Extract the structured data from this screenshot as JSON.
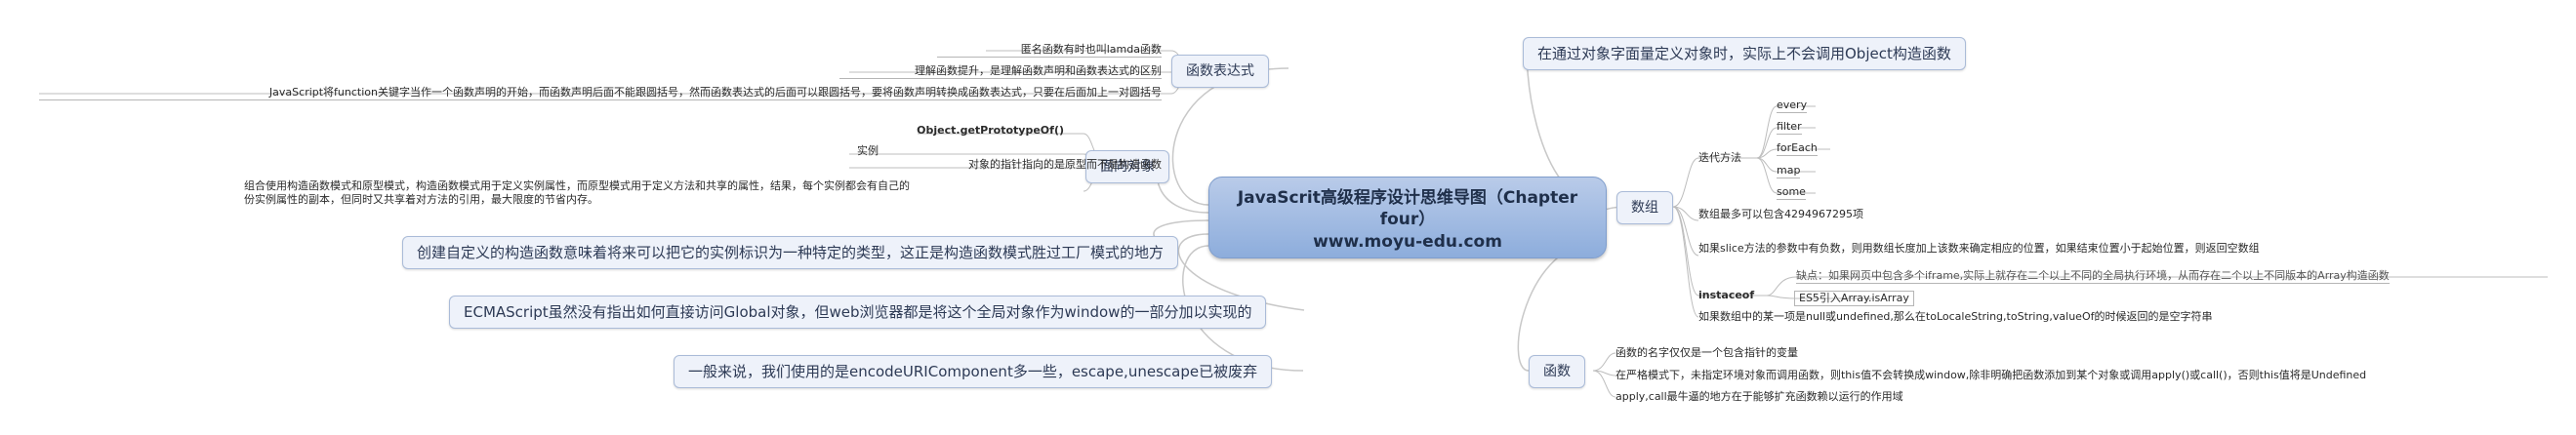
{
  "center": {
    "line1_prefix": "JavaScrit",
    "line1_rest": "高级程序设计思维导图（Chapter",
    "line2": "four）",
    "line3": "www.moyu-edu.com"
  },
  "left": {
    "fn_expr": {
      "label": "函数表达式",
      "items": [
        "匿名函数有时也叫lamda函数",
        "理解函数提升，是理解函数声明和函数表达式的区别",
        "JavaScript将function关键字当作一个函数声明的开始，而函数声明后面不能跟圆括号，然而函数表达式的后面可以跟圆括号，要将函数声明转换成函数表达式，只要在后面加上一对圆括号"
      ]
    },
    "oop": {
      "label": "面向对象",
      "items": [
        "Object.getPrototypeOf()",
        "实例",
        "对象的指针指向的是原型而不是构造函数",
        "组合使用构造函数模式和原型模式，构造函数模式用于定义实例属性，而原型模式用于定义方法和共享的属性，结果，每个实例都会有自己的",
        "份实例属性的副本，但同时又共享着对方法的引用，最大限度的节省内存。"
      ]
    },
    "custom_ctor": "创建自定义的构造函数意味着将来可以把它的实例标识为一种特定的类型，这正是构造函数模式胜过工厂模式的地方",
    "ecma": "ECMAScript虽然没有指出如何直接访问Global对象，但web浏览器都是将这个全局对象作为window的一部分加以实现的",
    "encode": "一般来说，我们使用的是encodeURIComponent多一些，escape,unescape已被废弃"
  },
  "right": {
    "object_literal": "在通过对象字面量定义对象时，实际上不会调用Object构造函数",
    "array": {
      "label": "数组",
      "iter_label": "迭代方法",
      "iter_items": [
        "every",
        "filter",
        "forEach",
        "map",
        "some"
      ],
      "max_len": "数组最多可以包含4294967295项",
      "slice": "如果slice方法的参数中有负数，则用数组长度加上该数来确定相应的位置，如果结束位置小于起始位置，则返回空数组",
      "instanceof_label": "instaceof",
      "instanceof_note": "缺点：如果网页中包含多个iframe,实际上就存在二个以上不同的全局执行环境，从而存在二个以上不同版本的Array构造函数",
      "instanceof_es5": "ES5引入Array.isArray",
      "null_item": "如果数组中的某一项是null或undefined,那么在toLocaleString,toString,valueOf的时候返回的是空字符串"
    },
    "function": {
      "label": "函数",
      "items": [
        "函数的名字仅仅是一个包含指针的变量",
        "在严格模式下，未指定环境对象而调用函数，则this值不会转换成window,除非明确把函数添加到某个对象或调用apply()或call()，否则this值将是Undefined",
        "apply,call最牛逼的地方在于能够扩充函数赖以运行的作用域"
      ]
    }
  }
}
